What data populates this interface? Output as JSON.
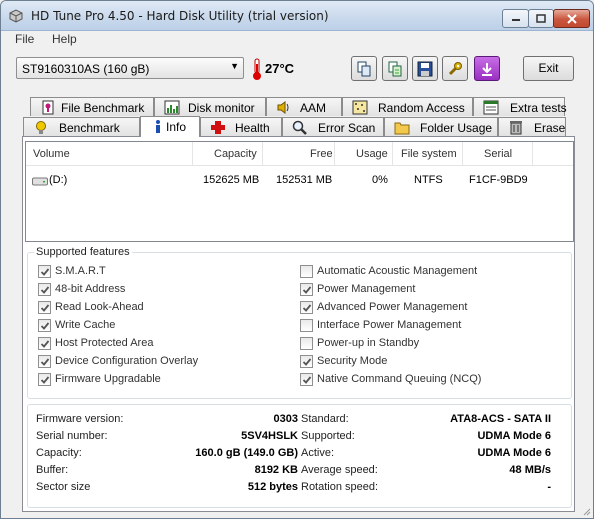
{
  "window": {
    "title": "HD Tune Pro 4.50 - Hard Disk Utility (trial version)"
  },
  "menu": {
    "file": "File",
    "help": "Help"
  },
  "toolbar": {
    "drive": "ST9160310AS (160 gB)",
    "temperature": "27°C",
    "buttons": [
      "copy-icon",
      "copy-info-icon",
      "save-icon",
      "options-icon",
      "download-icon"
    ],
    "exit_label": "Exit"
  },
  "tabs": {
    "row1": [
      "File Benchmark",
      "Disk monitor",
      "AAM",
      "Random Access",
      "Extra tests"
    ],
    "row2": [
      "Benchmark",
      "Info",
      "Health",
      "Error Scan",
      "Folder Usage",
      "Erase"
    ],
    "active": "Info"
  },
  "volumes": {
    "columns": [
      "Volume",
      "Capacity",
      "Free",
      "Usage",
      "File system",
      "Serial"
    ],
    "rows": [
      {
        "volume": "(D:)",
        "capacity": "152625 MB",
        "free": "152531 MB",
        "usage": "0%",
        "filesystem": "NTFS",
        "serial": "F1CF-9BD9"
      }
    ]
  },
  "features": {
    "title": "Supported features",
    "left": [
      {
        "label": "S.M.A.R.T",
        "checked": true
      },
      {
        "label": "48-bit Address",
        "checked": true
      },
      {
        "label": "Read Look-Ahead",
        "checked": true
      },
      {
        "label": "Write Cache",
        "checked": true
      },
      {
        "label": "Host Protected Area",
        "checked": true
      },
      {
        "label": "Device Configuration Overlay",
        "checked": true
      },
      {
        "label": "Firmware Upgradable",
        "checked": true
      }
    ],
    "right": [
      {
        "label": "Automatic Acoustic Management",
        "checked": false
      },
      {
        "label": "Power Management",
        "checked": true
      },
      {
        "label": "Advanced Power Management",
        "checked": true
      },
      {
        "label": "Interface Power Management",
        "checked": false
      },
      {
        "label": "Power-up in Standby",
        "checked": false
      },
      {
        "label": "Security Mode",
        "checked": true
      },
      {
        "label": "Native Command Queuing (NCQ)",
        "checked": true
      }
    ]
  },
  "info": {
    "left": [
      {
        "label": "Firmware version:",
        "value": "0303"
      },
      {
        "label": "Serial number:",
        "value": "5SV4HSLK"
      },
      {
        "label": "Capacity:",
        "value": "160.0 gB (149.0 GB)"
      },
      {
        "label": "Buffer:",
        "value": "8192 KB"
      },
      {
        "label": "Sector size",
        "value": "512 bytes"
      }
    ],
    "right": [
      {
        "label": "Standard:",
        "value": "ATA8-ACS - SATA II"
      },
      {
        "label": "Supported:",
        "value": "UDMA Mode 6"
      },
      {
        "label": "Active:",
        "value": "UDMA Mode 6"
      },
      {
        "label": "Average speed:",
        "value": "48 MB/s"
      },
      {
        "label": "Rotation speed:",
        "value": "-"
      }
    ]
  }
}
